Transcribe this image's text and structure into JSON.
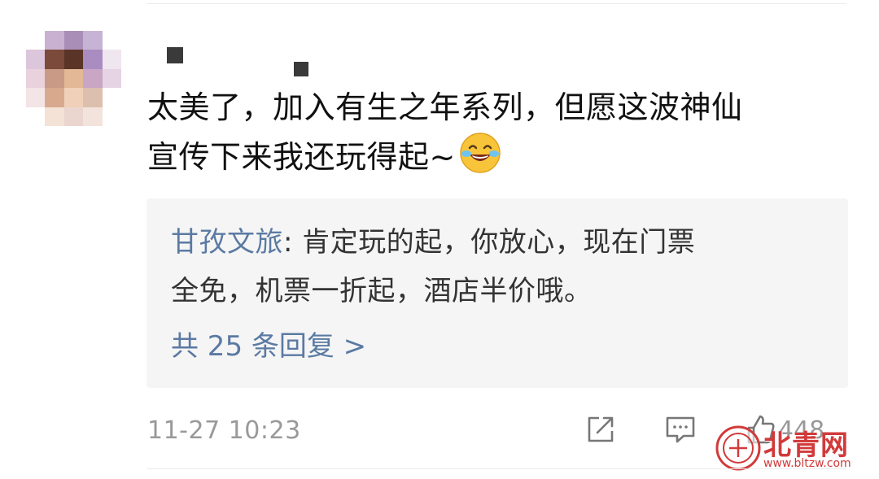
{
  "comment": {
    "line1": "太美了，加入有生之年系列，但愿这波神仙",
    "line2": "宣传下来我还玩得起~"
  },
  "reply": {
    "author": "甘孜文旅",
    "separator": ": ",
    "text_line1": "肯定玩的起，你放心，现在门票",
    "text_line2": "全免，机票一折起，酒店半价哦。",
    "count_label": "共 25 条回复 >"
  },
  "footer": {
    "timestamp": "11-27 10:23",
    "like_count": "448"
  },
  "watermark": {
    "text": "北青网",
    "url": "www.bltzw.com"
  },
  "icons": {
    "share": "share-icon",
    "comment": "comment-icon",
    "like": "like-icon",
    "emoji": "laughing-tears-emoji"
  },
  "colors": {
    "link": "#5b7aa3",
    "reply_bg": "#f5f5f5",
    "timestamp": "#999999",
    "watermark": "#d23a3a"
  }
}
